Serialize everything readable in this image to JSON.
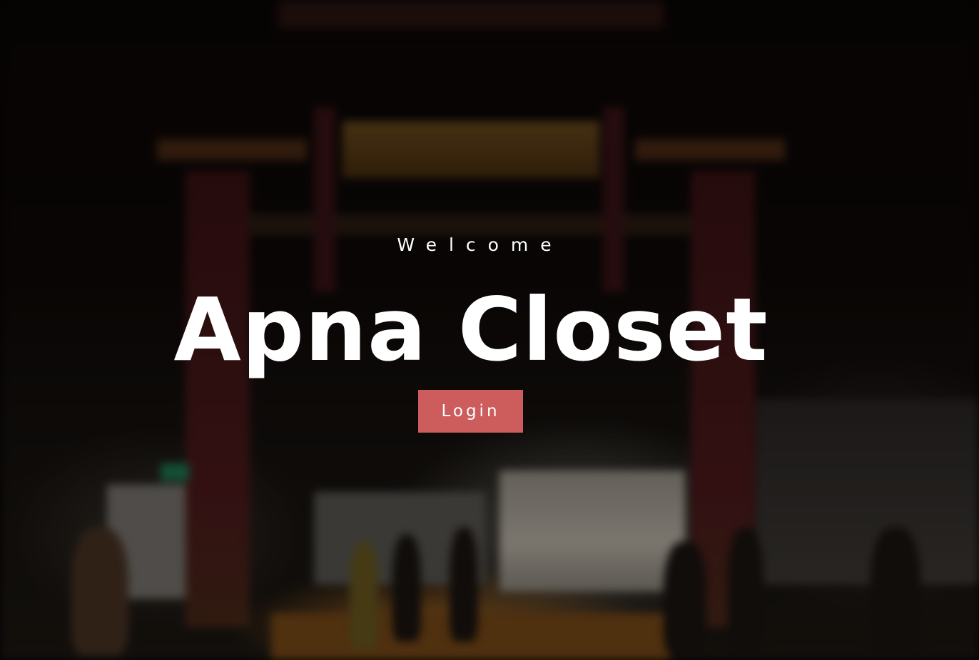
{
  "hero": {
    "welcome_text": "Welcome",
    "title": "Apna Closet",
    "login_label": "Login",
    "background_image": "blurred night street market under red gate"
  },
  "colors": {
    "button_background": "#cd5c5c",
    "text": "#ffffff",
    "overlay": "#000000"
  }
}
